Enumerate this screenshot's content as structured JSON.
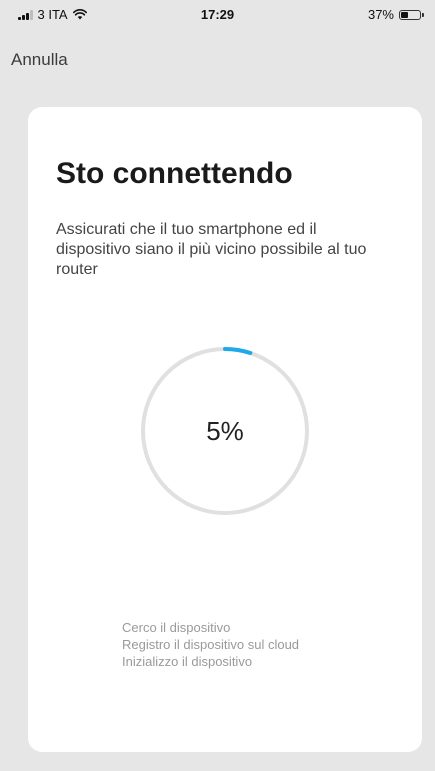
{
  "status_bar": {
    "carrier": "3 ITA",
    "time": "17:29",
    "battery_percent_label": "37%",
    "battery_level": 0.37,
    "signal_icon": "signal-bars-icon",
    "wifi_icon": "wifi-icon",
    "battery_icon": "battery-icon"
  },
  "nav": {
    "cancel_label": "Annulla"
  },
  "card": {
    "title": "Sto connettendo",
    "description": "Assicurati che il tuo smartphone ed il dispositivo siano il più vicino possibile al tuo router"
  },
  "progress": {
    "value": 0.05,
    "label": "5%",
    "track_color": "#e0e0e0",
    "fill_color": "#1fa9e8"
  },
  "steps": [
    "Cerco il dispositivo",
    "Registro il dispositivo sul cloud",
    "Inizializzo il dispositivo"
  ]
}
